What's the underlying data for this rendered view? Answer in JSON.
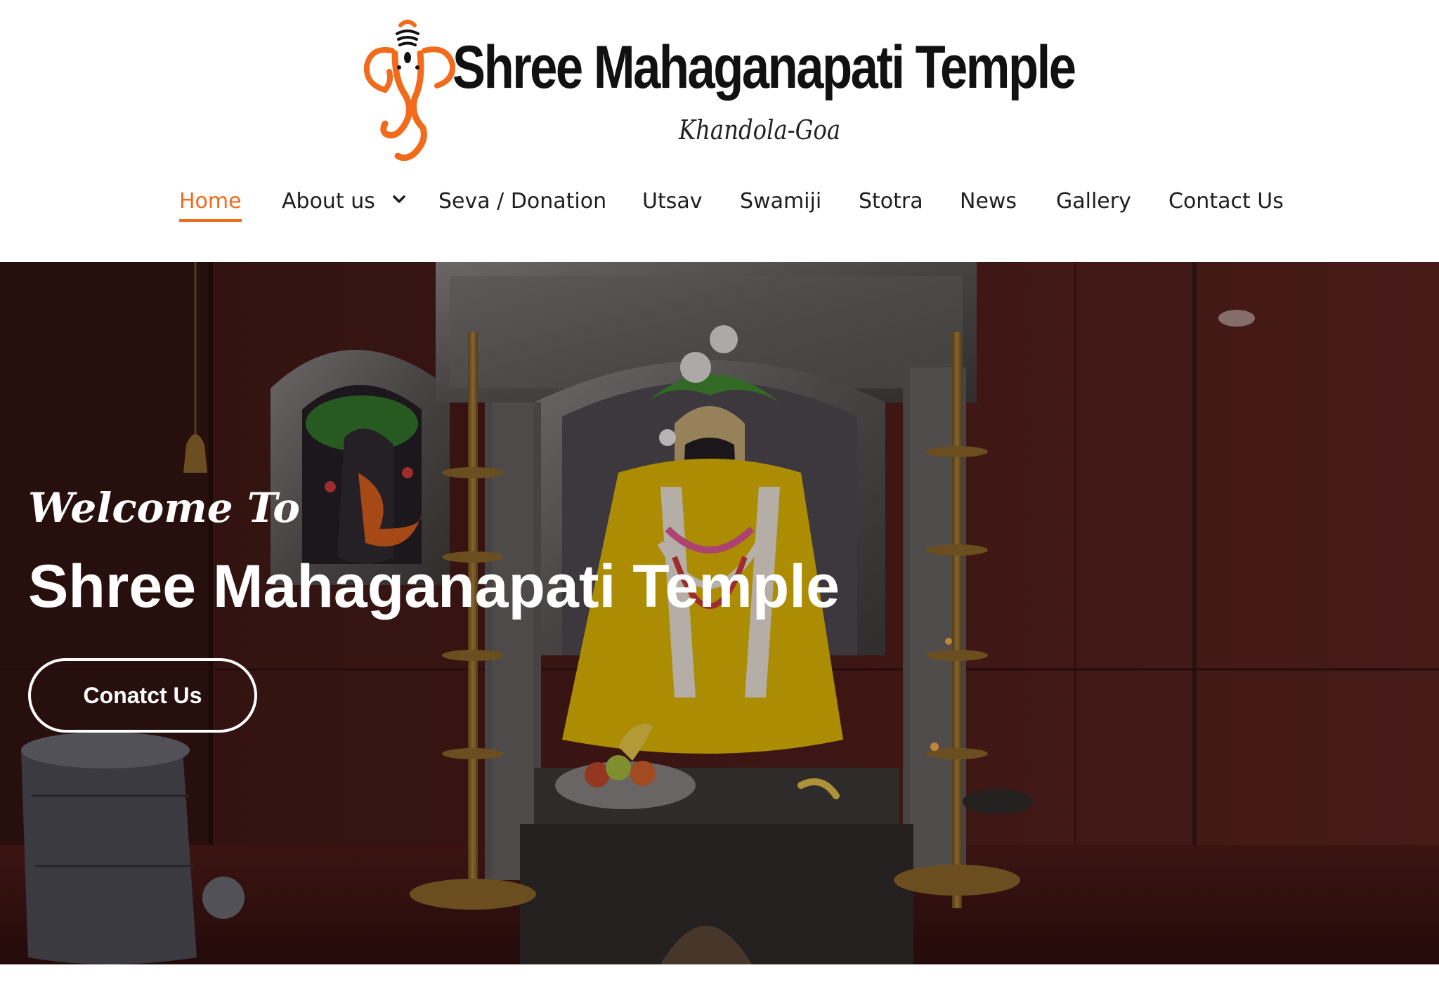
{
  "brand": {
    "title": "Shree Mahaganapati Temple",
    "subtitle": "Khandola-Goa",
    "accent_color": "#f26a1b",
    "logo_icon": "ganesha-logo-icon"
  },
  "nav": {
    "items": [
      {
        "label": "Home",
        "active": true
      },
      {
        "label": "About us",
        "has_dropdown": true,
        "icon": "chevron-down-icon"
      },
      {
        "label": "Seva / Donation"
      },
      {
        "label": "Utsav"
      },
      {
        "label": "Swamiji"
      },
      {
        "label": "Stotra"
      },
      {
        "label": "News"
      },
      {
        "label": "Gallery"
      },
      {
        "label": "Contact Us"
      }
    ]
  },
  "hero": {
    "welcome": "Welcome To",
    "title": "Shree Mahaganapati Temple",
    "button_label": "Conatct Us",
    "background": "temple-shrine-photo"
  }
}
